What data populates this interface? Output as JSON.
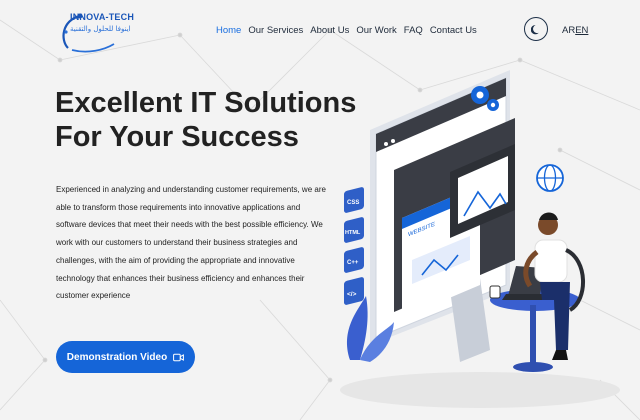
{
  "brand": {
    "name": "INNOVA-TECH",
    "tagline": "اينوفا للحلول والتقنية"
  },
  "nav": {
    "items": [
      {
        "label": "Home",
        "active": true
      },
      {
        "label": "Our Services",
        "active": false
      },
      {
        "label": "About Us",
        "active": false
      },
      {
        "label": "Our Work",
        "active": false
      },
      {
        "label": "FAQ",
        "active": false
      },
      {
        "label": "Contact Us",
        "active": false
      }
    ]
  },
  "header": {
    "theme_icon": "moon-icon",
    "lang_ar": "AR",
    "lang_en": "EN"
  },
  "hero": {
    "title_line1": "Excellent IT Solutions",
    "title_line2": "For Your Success",
    "paragraph": "Experienced in analyzing and understanding customer requirements, we are able to transform those requirements into innovative applications and software devices that meet their needs with the best possible efficiency. We work with our customers to understand their business strategies and challenges, with the aim of providing the appropriate and innovative technology that enhances their business efficiency and enhances their customer experience",
    "cta_label": "Demonstration Video",
    "cta_icon": "video-camera-icon"
  },
  "illustration": {
    "website_label": "WEBSITE",
    "tags": [
      "CSS",
      "HTML",
      "C++",
      "</>"
    ],
    "accent": "#1565d8",
    "dark": "#3a3d45"
  },
  "colors": {
    "primary": "#1565d8",
    "nav_active": "#1a6fe0",
    "background": "#f3f3f3",
    "text": "#222222"
  }
}
